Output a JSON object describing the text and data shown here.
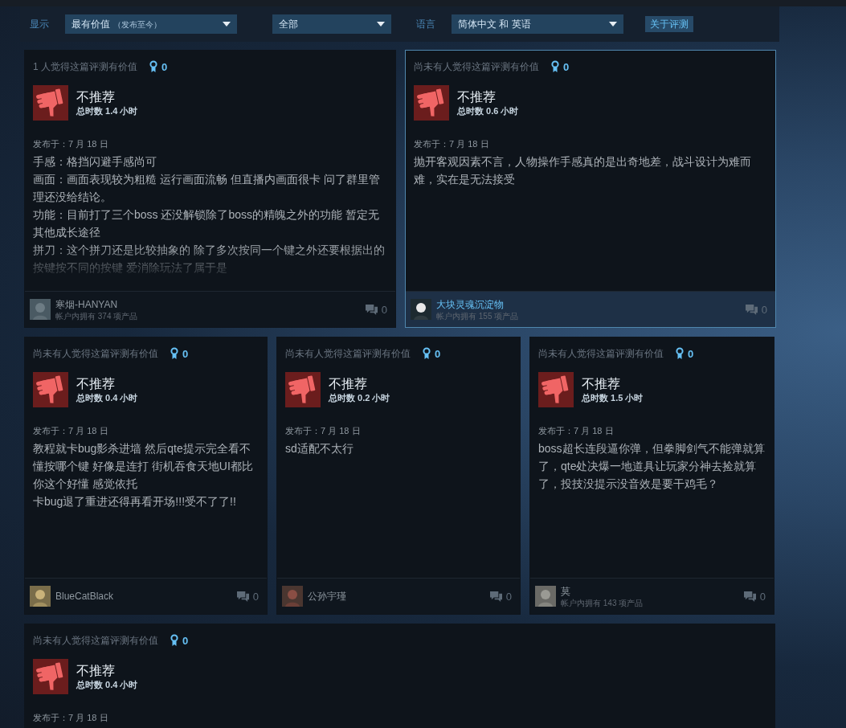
{
  "filters": {
    "display_label": "显示",
    "sort": {
      "value": "最有价值",
      "note": "（发布至今）"
    },
    "type": {
      "value": "全部"
    },
    "language_label": "语言",
    "language": {
      "value": "简体中文 和 英语"
    },
    "about_button": "关于评测"
  },
  "rows": [
    {
      "reviews": [
        {
          "helpful": "1 人觉得这篇评测有价值",
          "awards": "0",
          "recommended": false,
          "verdict": "不推荐",
          "hours": "总时数 1.4 小时",
          "posted": "发布于：7 月 18 日",
          "body": [
            "手感：格挡闪避手感尚可",
            "画面：画面表现较为粗糙 运行画面流畅 但直播内画面很卡 问了群里管理还没给结论。",
            "功能：目前打了三个boss 还没解锁除了boss的精魄之外的功能 暂定无其他成长途径",
            "拼刀：这个拼刀还是比较抽象的 除了多次按同一个键之外还要根据出的按键按不同的按键 爱消除玩法了属于是"
          ],
          "truncated": true,
          "author": "寒烟-HANYAN",
          "products": "帐户内拥有 374 项产品",
          "comments": "0",
          "selected": false
        },
        {
          "helpful": "尚未有人觉得这篇评测有价值",
          "awards": "0",
          "recommended": false,
          "verdict": "不推荐",
          "hours": "总时数 0.6 小时",
          "posted": "发布于：7 月 18 日",
          "body": [
            "抛开客观因素不言，人物操作手感真的是出奇地差，战斗设计为难而难，实在是无法接受"
          ],
          "author": "大块灵魂沉淀物",
          "products": "帐户内拥有 155 项产品",
          "comments": "0",
          "selected": true
        }
      ]
    },
    {
      "reviews": [
        {
          "helpful": "尚未有人觉得这篇评测有价值",
          "awards": "0",
          "recommended": false,
          "verdict": "不推荐",
          "hours": "总时数 0.4 小时",
          "posted": "发布于：7 月 18 日",
          "body": [
            "教程就卡bug影杀进墙 然后qte提示完全看不懂按哪个键 好像是连打 街机吞食天地UI都比你这个好懂 感觉依托",
            "卡bug退了重进还得再看开场!!!受不了了!!"
          ],
          "author": "BlueCatBlack",
          "comments": "0",
          "selected": false
        },
        {
          "helpful": "尚未有人觉得这篇评测有价值",
          "awards": "0",
          "recommended": false,
          "verdict": "不推荐",
          "hours": "总时数 0.2 小时",
          "posted": "发布于：7 月 18 日",
          "body": [
            "sd适配不太行"
          ],
          "author": "公孙宇瑾",
          "comments": "0",
          "selected": false
        },
        {
          "helpful": "尚未有人觉得这篇评测有价值",
          "awards": "0",
          "recommended": false,
          "verdict": "不推荐",
          "hours": "总时数 1.5 小时",
          "posted": "发布于：7 月 18 日",
          "body": [
            "boss超长连段逼你弹，但拳脚剑气不能弹就算了，qte处决爆一地道具让玩家分神去捡就算了，投技没提示没音效是要干鸡毛？"
          ],
          "author": "莫",
          "products": "帐户内拥有 143 项产品",
          "comments": "0",
          "selected": false
        }
      ]
    },
    {
      "reviews": [
        {
          "helpful": "尚未有人觉得这篇评测有价值",
          "awards": "0",
          "recommended": false,
          "verdict": "不推荐",
          "hours": "总时数 0.4 小时",
          "posted": "发布于：7 月 18 日",
          "selected": false
        }
      ]
    }
  ]
}
